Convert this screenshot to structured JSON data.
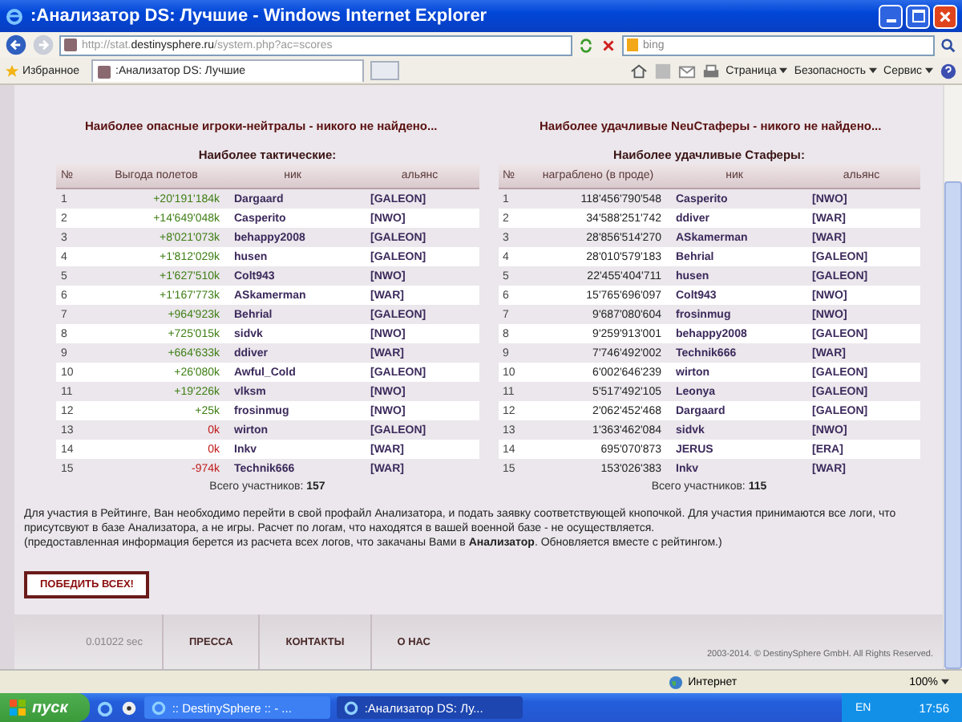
{
  "window": {
    "title": ":Анализатор DS: Лучшие - Windows Internet Explorer"
  },
  "toolbar": {
    "address": "http://stat.**destinysphere.ru**/system.php?ac=scores",
    "search_placeholder": "bing",
    "favorites": "Избранное",
    "tab": ":Анализатор DS: Лучшие",
    "menus": [
      "Страница",
      "Безопасность",
      "Сервис"
    ]
  },
  "page": {
    "headings": [
      "Наиболее опасные игроки-нейтралы - никого не найдено...",
      "Наиболее удачливые NeuСтаферы - никого не найдено..."
    ],
    "tables": [
      {
        "title": "Наиболее тактические:",
        "columns": [
          "№",
          "Выгода полетов",
          "ник",
          "альянс"
        ],
        "total": "Всего участников: **157**",
        "rows": [
          {
            "rank": "1",
            "value": "+20'191'184k",
            "kind": "gain",
            "nick": "Dargaard",
            "alliance": "[GALEON]"
          },
          {
            "rank": "2",
            "value": "+14'649'048k",
            "kind": "gain",
            "nick": "Casperito",
            "alliance": "[NWO]"
          },
          {
            "rank": "3",
            "value": "+8'021'073k",
            "kind": "gain",
            "nick": "behappy2008",
            "alliance": "[GALEON]"
          },
          {
            "rank": "4",
            "value": "+1'812'029k",
            "kind": "gain",
            "nick": "husen",
            "alliance": "[GALEON]"
          },
          {
            "rank": "5",
            "value": "+1'627'510k",
            "kind": "gain",
            "nick": "Colt943",
            "alliance": "[NWO]"
          },
          {
            "rank": "6",
            "value": "+1'167'773k",
            "kind": "gain",
            "nick": "ASkamerman",
            "alliance": "[WAR]"
          },
          {
            "rank": "7",
            "value": "+964'923k",
            "kind": "gain",
            "nick": "Behrial",
            "alliance": "[GALEON]"
          },
          {
            "rank": "8",
            "value": "+725'015k",
            "kind": "gain",
            "nick": "sidvk",
            "alliance": "[NWO]"
          },
          {
            "rank": "9",
            "value": "+664'633k",
            "kind": "gain",
            "nick": "ddiver",
            "alliance": "[WAR]"
          },
          {
            "rank": "10",
            "value": "+26'080k",
            "kind": "gain",
            "nick": "Awful_Cold",
            "alliance": "[GALEON]"
          },
          {
            "rank": "11",
            "value": "+19'226k",
            "kind": "gain",
            "nick": "vlksm",
            "alliance": "[NWO]"
          },
          {
            "rank": "12",
            "value": "+25k",
            "kind": "gain",
            "nick": "frosinmug",
            "alliance": "[NWO]"
          },
          {
            "rank": "13",
            "value": "0k",
            "kind": "loss",
            "nick": "wirton",
            "alliance": "[GALEON]"
          },
          {
            "rank": "14",
            "value": "0k",
            "kind": "loss",
            "nick": "Inkv",
            "alliance": "[WAR]"
          },
          {
            "rank": "15",
            "value": "-974k",
            "kind": "loss",
            "nick": "Technik666",
            "alliance": "[WAR]"
          }
        ]
      },
      {
        "title": "Наиболее удачливые Стаферы:",
        "columns": [
          "№",
          "награблено (в проде)",
          "ник",
          "альянс"
        ],
        "total": "Всего участников: **115**",
        "rows": [
          {
            "rank": "1",
            "value": "118'456'790'548",
            "kind": "plain",
            "nick": "Casperito",
            "alliance": "[NWO]"
          },
          {
            "rank": "2",
            "value": "34'588'251'742",
            "kind": "plain",
            "nick": "ddiver",
            "alliance": "[WAR]"
          },
          {
            "rank": "3",
            "value": "28'856'514'270",
            "kind": "plain",
            "nick": "ASkamerman",
            "alliance": "[WAR]"
          },
          {
            "rank": "4",
            "value": "28'010'579'183",
            "kind": "plain",
            "nick": "Behrial",
            "alliance": "[GALEON]"
          },
          {
            "rank": "5",
            "value": "22'455'404'711",
            "kind": "plain",
            "nick": "husen",
            "alliance": "[GALEON]"
          },
          {
            "rank": "6",
            "value": "15'765'696'097",
            "kind": "plain",
            "nick": "Colt943",
            "alliance": "[NWO]"
          },
          {
            "rank": "7",
            "value": "9'687'080'604",
            "kind": "plain",
            "nick": "frosinmug",
            "alliance": "[NWO]"
          },
          {
            "rank": "8",
            "value": "9'259'913'001",
            "kind": "plain",
            "nick": "behappy2008",
            "alliance": "[GALEON]"
          },
          {
            "rank": "9",
            "value": "7'746'492'002",
            "kind": "plain",
            "nick": "Technik666",
            "alliance": "[WAR]"
          },
          {
            "rank": "10",
            "value": "6'002'646'239",
            "kind": "plain",
            "nick": "wirton",
            "alliance": "[GALEON]"
          },
          {
            "rank": "11",
            "value": "5'517'492'105",
            "kind": "plain",
            "nick": "Leonya",
            "alliance": "[GALEON]"
          },
          {
            "rank": "12",
            "value": "2'062'452'468",
            "kind": "plain",
            "nick": "Dargaard",
            "alliance": "[GALEON]"
          },
          {
            "rank": "13",
            "value": "1'363'462'084",
            "kind": "plain",
            "nick": "sidvk",
            "alliance": "[NWO]"
          },
          {
            "rank": "14",
            "value": "695'070'873",
            "kind": "plain",
            "nick": "JERUS",
            "alliance": "[ERA]"
          },
          {
            "rank": "15",
            "value": "153'026'383",
            "kind": "plain",
            "nick": "Inkv",
            "alliance": "[WAR]"
          }
        ]
      }
    ],
    "note": [
      "Для участия в Рейтинге, Ван необходимо перейти в свой профайл Анализатора, и подать заявку соответствующей кнопочкой. Для участия принимаются все логи, что присутсвуют в базе Анализатора, а не игры. Расчет по логам, что находятся в вашей военной базе - не осуществляется.",
      "(предоставленная информация берется из расчета всех логов, что закачаны Вами в **Анализатор**. Обновляется вместе с рейтингом.)"
    ],
    "button": "ПОБЕДИТЬ ВСЕХ!"
  },
  "footer": {
    "timing": "0.01022 sec",
    "links": [
      "ПРЕССА",
      "КОНТАКТЫ",
      "О НАС"
    ],
    "copyright": "2003-2014. © DestinySphere GmbH. All Rights Reserved."
  },
  "status_bar": {
    "zone": "Интернет",
    "zoom": "100%"
  },
  "taskbar": {
    "start": "пуск",
    "tasks": [
      {
        "label": ":: DestinySphere :: - ...",
        "selected": false
      },
      {
        "label": ":Анализатор DS: Лу...",
        "selected": true
      }
    ],
    "lang": "EN",
    "clock": "17:56"
  }
}
